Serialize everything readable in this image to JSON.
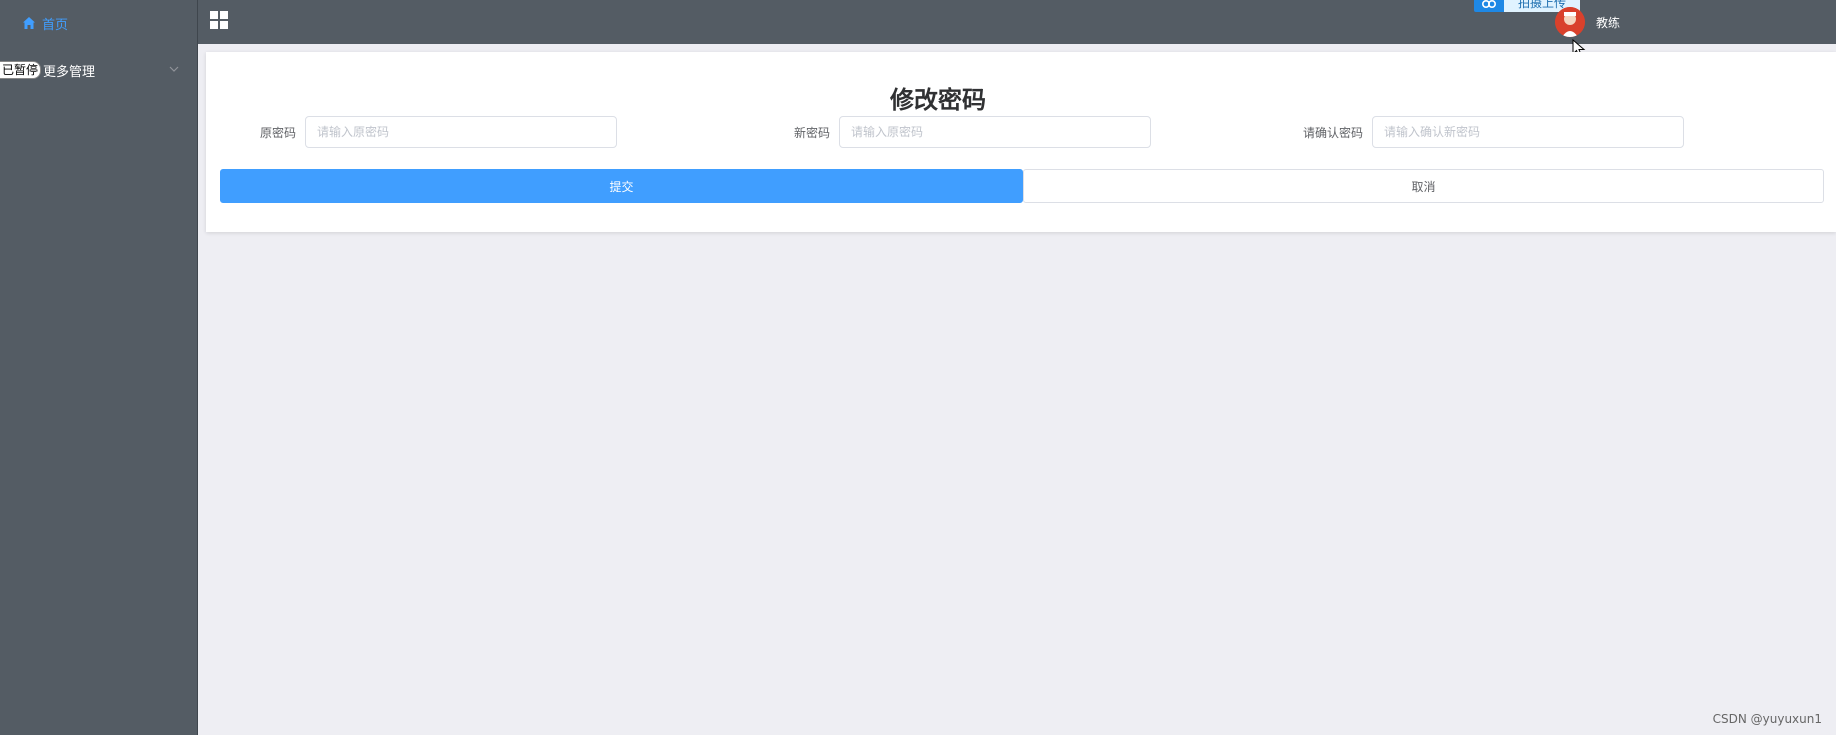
{
  "sidebar": {
    "home_label": "首页",
    "more_label": "更多管理",
    "overlay_text": "已暂停"
  },
  "header": {
    "upload_label": "拍摄上传",
    "user_name": "教练"
  },
  "form": {
    "title": "修改密码",
    "fields": [
      {
        "label": "原密码",
        "placeholder": "请输入原密码"
      },
      {
        "label": "新密码",
        "placeholder": "请输入原密码"
      },
      {
        "label": "请确认密码",
        "placeholder": "请输入确认新密码"
      }
    ],
    "submit_label": "提交",
    "cancel_label": "取消"
  },
  "watermark": "CSDN @yuyuxun1",
  "colors": {
    "sidebar_bg": "#545c64",
    "accent": "#409eff",
    "page_bg": "#eeeef3"
  },
  "icons": [
    "home-icon",
    "chevron-down-icon",
    "grid-icon",
    "upload-icon",
    "avatar",
    "cursor-icon"
  ]
}
